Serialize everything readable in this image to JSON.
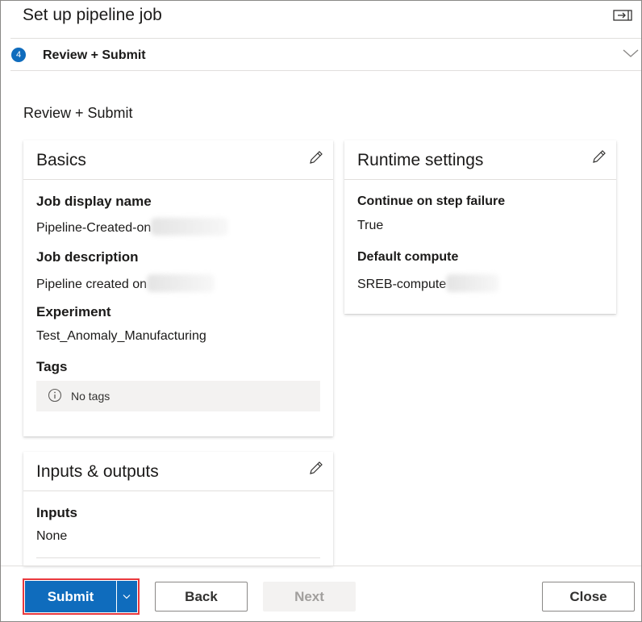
{
  "panel": {
    "title": "Set up pipeline job",
    "collapse_icon": "collapse-panel-icon"
  },
  "step": {
    "number": "4",
    "label": "Review + Submit",
    "chevron_icon": "chevron-down-icon"
  },
  "section_heading": "Review + Submit",
  "basics": {
    "title": "Basics",
    "job_display_name_label": "Job display name",
    "job_display_name_value": "Pipeline-Created-on",
    "job_description_label": "Job description",
    "job_description_value": "Pipeline created on",
    "experiment_label": "Experiment",
    "experiment_value": "Test_Anomaly_Manufacturing",
    "tags_label": "Tags",
    "tags_empty": "No tags"
  },
  "runtime": {
    "title": "Runtime settings",
    "continue_label": "Continue on step failure",
    "continue_value": "True",
    "compute_label": "Default compute",
    "compute_value": "SREB-compute"
  },
  "io": {
    "title": "Inputs & outputs",
    "inputs_label": "Inputs",
    "inputs_value": "None"
  },
  "footer": {
    "submit_label": "Submit",
    "back_label": "Back",
    "next_label": "Next",
    "close_label": "Close"
  },
  "colors": {
    "accent": "#0f6cbd",
    "highlight": "#e8383d"
  }
}
